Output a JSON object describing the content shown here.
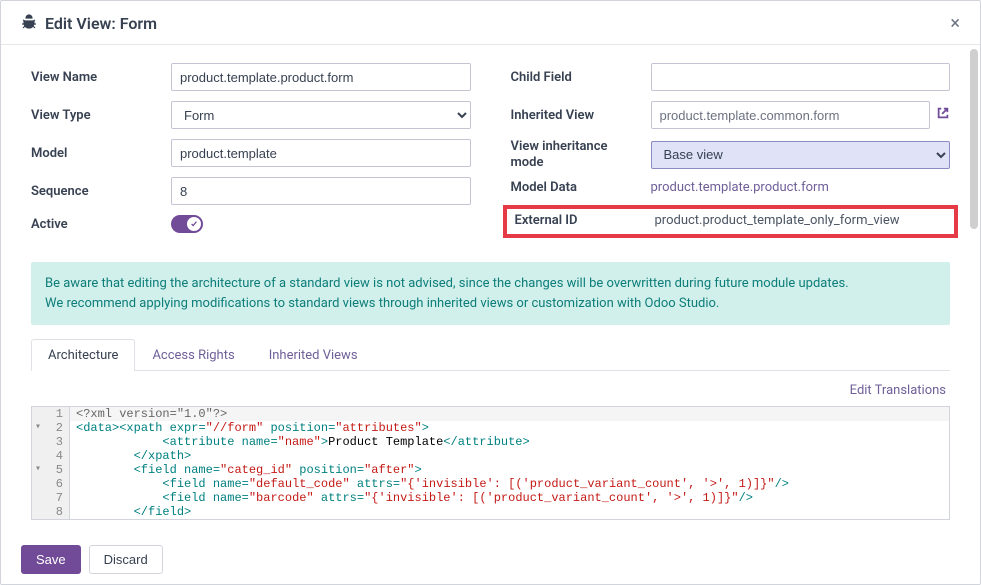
{
  "header": {
    "title": "Edit View: Form"
  },
  "left": {
    "view_name": {
      "label": "View Name",
      "value": "product.template.product.form"
    },
    "view_type": {
      "label": "View Type",
      "value": "Form"
    },
    "model": {
      "label": "Model",
      "value": "product.template"
    },
    "sequence": {
      "label": "Sequence",
      "value": "8"
    },
    "active": {
      "label": "Active"
    }
  },
  "right": {
    "child_field": {
      "label": "Child Field",
      "value": ""
    },
    "inherited_view": {
      "label": "Inherited View",
      "value": "product.template.common.form"
    },
    "inherit_mode": {
      "label": "View inheritance mode",
      "value": "Base view"
    },
    "model_data": {
      "label": "Model Data",
      "value": "product.template.product.form"
    },
    "external_id": {
      "label": "External ID",
      "value": "product.product_template_only_form_view"
    }
  },
  "info": {
    "line1": "Be aware that editing the architecture of a standard view is not advised, since the changes will be overwritten during future module updates.",
    "line2": "We recommend applying modifications to standard views through inherited views or customization with Odoo Studio."
  },
  "tabs": {
    "architecture": "Architecture",
    "access_rights": "Access Rights",
    "inherited_views": "Inherited Views"
  },
  "edit_translations": "Edit Translations",
  "code": [
    {
      "n": 1,
      "fold": "",
      "raw": "<?xml version=\"1.0\"?>"
    },
    {
      "n": 2,
      "fold": "▾",
      "raw": "<data><xpath expr=\"//form\" position=\"attributes\">"
    },
    {
      "n": 3,
      "fold": "",
      "raw": "            <attribute name=\"name\">Product Template</attribute>"
    },
    {
      "n": 4,
      "fold": "",
      "raw": "        </xpath>"
    },
    {
      "n": 5,
      "fold": "▾",
      "raw": "        <field name=\"categ_id\" position=\"after\">"
    },
    {
      "n": 6,
      "fold": "",
      "raw": "            <field name=\"default_code\" attrs=\"{'invisible': [('product_variant_count', '&gt;', 1)]}\"/>"
    },
    {
      "n": 7,
      "fold": "",
      "raw": "            <field name=\"barcode\" attrs=\"{'invisible': [('product_variant_count', '&gt;', 1)]}\"/>"
    },
    {
      "n": 8,
      "fold": "",
      "raw": "        </field>"
    }
  ],
  "footer": {
    "save": "Save",
    "discard": "Discard"
  }
}
